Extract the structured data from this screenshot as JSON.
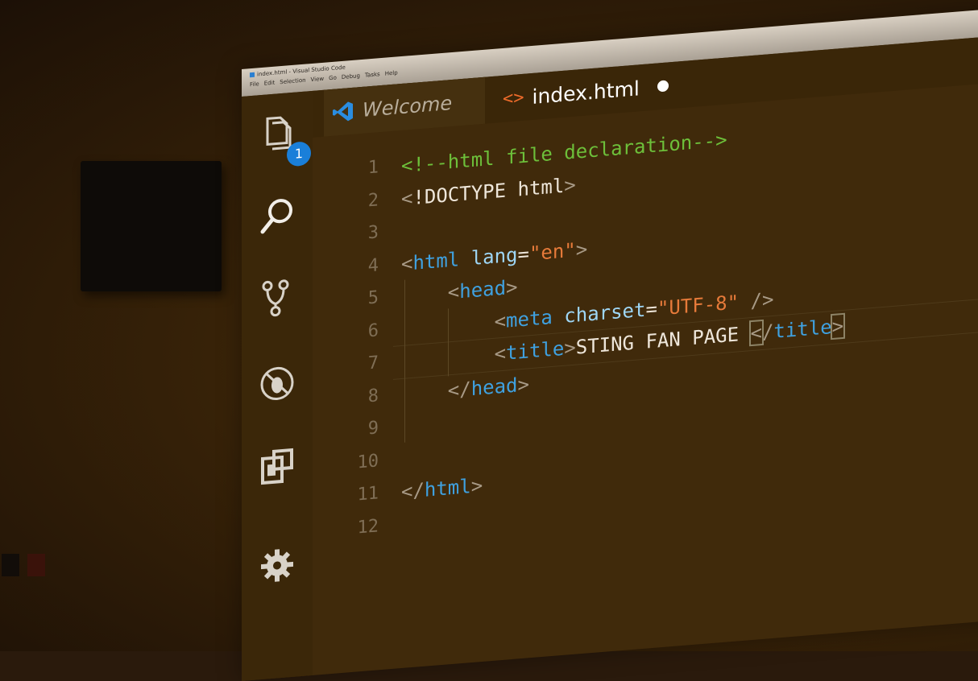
{
  "window": {
    "title": "index.html - Visual Studio Code",
    "menu": [
      "File",
      "Edit",
      "Selection",
      "View",
      "Go",
      "Debug",
      "Tasks",
      "Help"
    ]
  },
  "activity_bar": {
    "items": [
      {
        "name": "explorer-icon",
        "badge": "1"
      },
      {
        "name": "search-icon"
      },
      {
        "name": "source-control-icon"
      },
      {
        "name": "debug-icon"
      },
      {
        "name": "extensions-icon"
      },
      {
        "name": "settings-gear-icon"
      }
    ]
  },
  "tabs": [
    {
      "label": "Welcome",
      "icon": "vscode-icon",
      "active": false
    },
    {
      "label": "index.html",
      "icon": "html-icon",
      "active": true,
      "modified": true
    }
  ],
  "editor": {
    "line_numbers": [
      "1",
      "2",
      "3",
      "4",
      "5",
      "6",
      "7",
      "8",
      "9",
      "10",
      "11",
      "12"
    ],
    "lines": [
      {
        "tokens": [
          {
            "t": "cm",
            "v": "<!--html file declaration-->"
          }
        ]
      },
      {
        "tokens": [
          {
            "t": "pu",
            "v": "<"
          },
          {
            "t": "tx",
            "v": "!DOCTYPE html"
          },
          {
            "t": "pu",
            "v": ">"
          }
        ]
      },
      {
        "tokens": []
      },
      {
        "tokens": [
          {
            "t": "pu",
            "v": "<"
          },
          {
            "t": "tg",
            "v": "html"
          },
          {
            "t": "tx",
            "v": " "
          },
          {
            "t": "at",
            "v": "lang"
          },
          {
            "t": "tx",
            "v": "="
          },
          {
            "t": "st",
            "v": "\"en\""
          },
          {
            "t": "pu",
            "v": ">"
          }
        ]
      },
      {
        "tokens": [
          {
            "t": "tx",
            "v": "    "
          },
          {
            "t": "pu",
            "v": "<"
          },
          {
            "t": "tg",
            "v": "head"
          },
          {
            "t": "pu",
            "v": ">"
          }
        ]
      },
      {
        "tokens": [
          {
            "t": "tx",
            "v": "        "
          },
          {
            "t": "pu",
            "v": "<"
          },
          {
            "t": "tg",
            "v": "meta"
          },
          {
            "t": "tx",
            "v": " "
          },
          {
            "t": "at",
            "v": "charset"
          },
          {
            "t": "tx",
            "v": "="
          },
          {
            "t": "st",
            "v": "\"UTF-8\""
          },
          {
            "t": "tx",
            "v": " "
          },
          {
            "t": "pu",
            "v": "/>"
          }
        ]
      },
      {
        "tokens": [
          {
            "t": "tx",
            "v": "        "
          },
          {
            "t": "pu",
            "v": "<"
          },
          {
            "t": "tg",
            "v": "title"
          },
          {
            "t": "pu",
            "v": ">"
          },
          {
            "t": "tx",
            "v": "STING FAN PAGE "
          },
          {
            "t": "pu",
            "v": "<",
            "hl": true
          },
          {
            "t": "pu",
            "v": "/"
          },
          {
            "t": "tg",
            "v": "title"
          },
          {
            "t": "pu",
            "v": ">",
            "hl": true
          }
        ]
      },
      {
        "tokens": [
          {
            "t": "tx",
            "v": "    "
          },
          {
            "t": "pu",
            "v": "</"
          },
          {
            "t": "tg",
            "v": "head"
          },
          {
            "t": "pu",
            "v": ">"
          }
        ]
      },
      {
        "tokens": []
      },
      {
        "tokens": []
      },
      {
        "tokens": [
          {
            "t": "pu",
            "v": "</"
          },
          {
            "t": "tg",
            "v": "html"
          },
          {
            "t": "pu",
            "v": ">"
          }
        ]
      },
      {
        "tokens": []
      }
    ]
  },
  "colors": {
    "comment": "#6dbf3a",
    "tag": "#3fa1e0",
    "attribute": "#9ed6f5",
    "string": "#e67a3a",
    "badge": "#1a7fd9"
  }
}
